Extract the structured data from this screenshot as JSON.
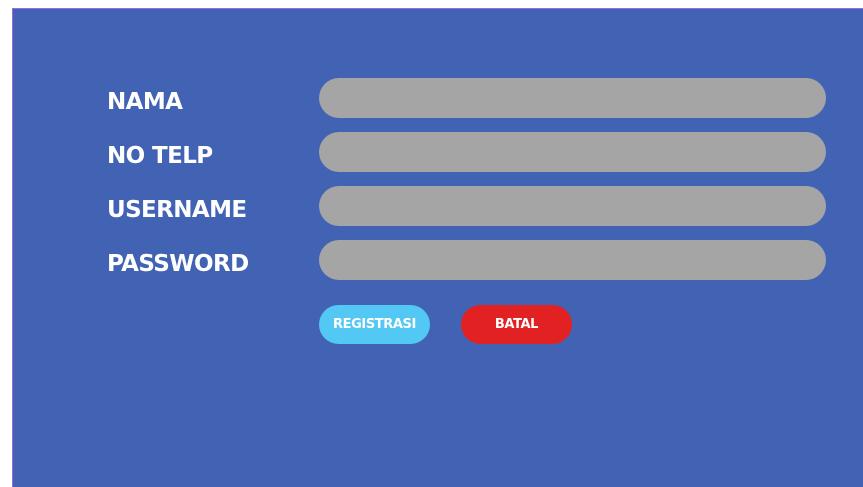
{
  "form": {
    "fields": [
      {
        "label": "NAMA",
        "value": "",
        "placeholder": ""
      },
      {
        "label": "NO TELP",
        "value": "",
        "placeholder": ""
      },
      {
        "label": "USERNAME",
        "value": "",
        "placeholder": ""
      },
      {
        "label": "PASSWORD",
        "value": "",
        "placeholder": ""
      }
    ]
  },
  "buttons": {
    "register_label": "REGISTRASI",
    "cancel_label": "BATAL"
  },
  "colors": {
    "background": "#4262b3",
    "field": "#a5a5a5",
    "register_button": "#54c8f4",
    "cancel_button": "#e22222",
    "text": "#ffffff"
  }
}
